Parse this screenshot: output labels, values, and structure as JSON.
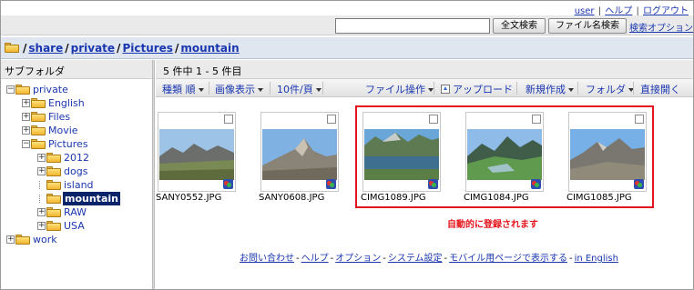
{
  "top_links": {
    "user": "user",
    "help": "ヘルプ",
    "logout": "ログアウト",
    "separator": "|"
  },
  "search": {
    "input_value": "",
    "fulltext_button": "全文検索",
    "filename_button": "ファイル名検索",
    "options_link": "検索オプション"
  },
  "breadcrumb": {
    "separator": "/",
    "items": [
      "share",
      "private",
      "Pictures",
      "mountain"
    ]
  },
  "sidebar": {
    "title": "サブフォルダ",
    "tree": [
      {
        "label": "private",
        "toggle": "−",
        "depth": 0,
        "open": true
      },
      {
        "label": "English",
        "toggle": "+",
        "depth": 1
      },
      {
        "label": "Files",
        "toggle": "+",
        "depth": 1
      },
      {
        "label": "Movie",
        "toggle": "+",
        "depth": 1
      },
      {
        "label": "Pictures",
        "toggle": "−",
        "depth": 1,
        "open": true
      },
      {
        "label": "2012",
        "toggle": "+",
        "depth": 2
      },
      {
        "label": "dogs",
        "toggle": "+",
        "depth": 2
      },
      {
        "label": "island",
        "toggle": "",
        "depth": 2
      },
      {
        "label": "mountain",
        "toggle": "",
        "depth": 2,
        "selected": true
      },
      {
        "label": "RAW",
        "toggle": "+",
        "depth": 2
      },
      {
        "label": "USA",
        "toggle": "+",
        "depth": 2
      },
      {
        "label": "work",
        "toggle": "+",
        "depth": 0
      }
    ]
  },
  "content": {
    "count_text": "5 件中 1 - 5 件目",
    "toolbar": {
      "sort": "種類 順",
      "view": "画像表示",
      "per_page": "10件/頁",
      "file_ops": "ファイル操作",
      "upload": "アップロード",
      "new": "新規作成",
      "folder": "フォルダ",
      "direct_open": "直接開く"
    },
    "files": [
      {
        "name": "SANY0552.JPG",
        "scene": "valley"
      },
      {
        "name": "SANY0608.JPG",
        "scene": "peak"
      },
      {
        "name": "CIMG1089.JPG",
        "scene": "lake"
      },
      {
        "name": "CIMG1084.JPG",
        "scene": "green"
      },
      {
        "name": "CIMG1085.JPG",
        "scene": "ridge"
      }
    ],
    "auto_note": "自動的に登録されます"
  },
  "footer": {
    "links": [
      "お問い合わせ",
      "ヘルプ",
      "オプション",
      "システム設定",
      "モバイル用ページで表示する",
      "in English"
    ],
    "separator": "-"
  },
  "colors": {
    "link": "#1a37b0",
    "highlight": "#e4161d",
    "selected_bg": "#0a246a"
  }
}
